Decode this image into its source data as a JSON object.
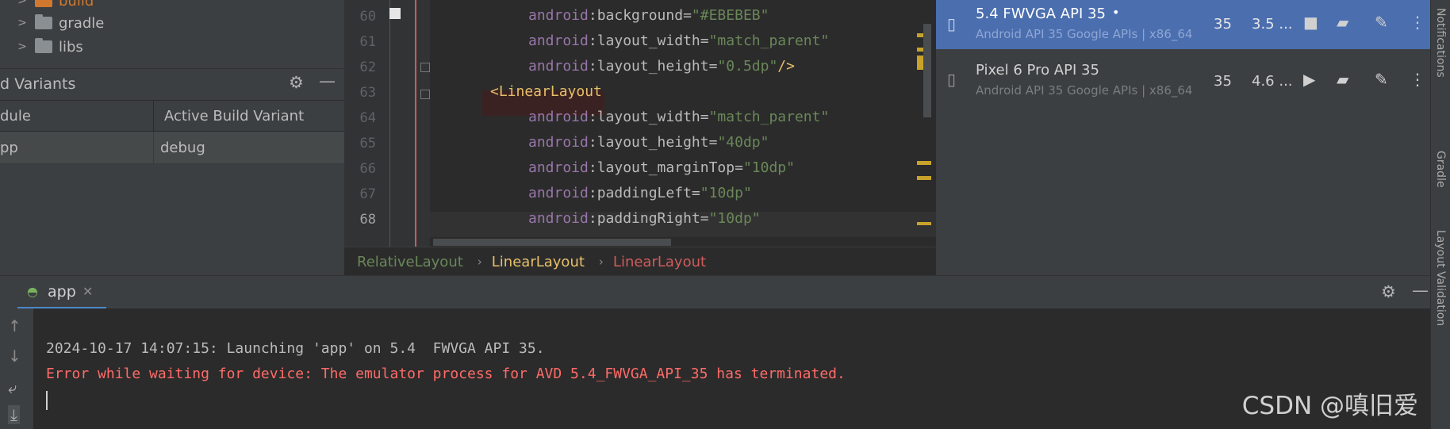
{
  "project_tree": {
    "items": [
      {
        "label": "build",
        "color": "#d1782e"
      },
      {
        "label": "gradle"
      },
      {
        "label": "libs"
      }
    ]
  },
  "build_variants": {
    "title": "d Variants",
    "columns": [
      "dule",
      "Active Build Variant"
    ],
    "rows": [
      {
        "module": "pp",
        "variant": "debug"
      }
    ]
  },
  "editor": {
    "lines": [
      {
        "num": "60",
        "attr": "background",
        "value": "\"#EBEBEB\"",
        "suffix": ""
      },
      {
        "num": "61",
        "attr": "layout_width",
        "value": "\"match_parent\"",
        "suffix": ""
      },
      {
        "num": "62",
        "attr": "layout_height",
        "value": "\"0.5dp\"",
        "suffix": "/>"
      },
      {
        "num": "63",
        "tag": "<LinearLayout"
      },
      {
        "num": "64",
        "attr": "layout_width",
        "value": "\"match_parent\"",
        "suffix": ""
      },
      {
        "num": "65",
        "attr": "layout_height",
        "value": "\"40dp\"",
        "suffix": ""
      },
      {
        "num": "66",
        "attr": "layout_marginTop",
        "value": "\"10dp\"",
        "suffix": ""
      },
      {
        "num": "67",
        "attr": "paddingLeft",
        "value": "\"10dp\"",
        "suffix": ""
      },
      {
        "num": "68",
        "attr": "paddingRight",
        "value": "\"10dp\"",
        "suffix": ""
      }
    ],
    "namespace": "android",
    "breadcrumbs": [
      "RelativeLayout",
      "LinearLayout",
      "LinearLayout"
    ]
  },
  "devices": [
    {
      "name": "5.4  FWVGA API 35",
      "status_dot": "•",
      "sub": "Android API 35 Google APIs | x86_64",
      "api": "35",
      "size": "3.5 ...",
      "selected": true
    },
    {
      "name": "Pixel 6 Pro API 35",
      "status_dot": "",
      "sub": "Android API 35 Google APIs | x86_64",
      "api": "35",
      "size": "4.6 ...",
      "selected": false
    }
  ],
  "right_strip": [
    "Notifications",
    "Gradle",
    "Layout Validation"
  ],
  "run": {
    "tab_label": "app",
    "console": [
      {
        "text": "2024-10-17 14:07:15: Launching 'app' on 5.4  FWVGA API 35.",
        "color": "#bbbbbb"
      },
      {
        "text": "Error while waiting for device: The emulator process for AVD 5.4_FWVGA_API_35 has terminated.",
        "color": "#ff6b68"
      }
    ]
  },
  "watermark": "CSDN @嗔旧爱"
}
